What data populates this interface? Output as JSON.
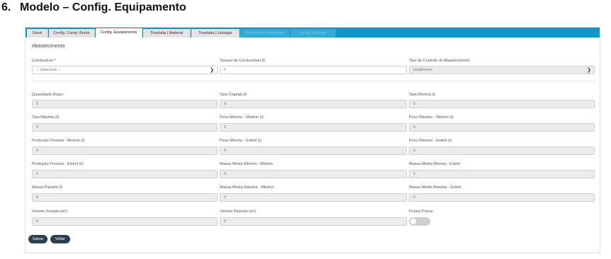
{
  "document": {
    "section_number": "6.",
    "section_title": "Modelo – Config. Equipamento"
  },
  "tabs": [
    {
      "label": "Geral",
      "state": "normal"
    },
    {
      "label": "Config. Comp. Bordo",
      "state": "normal"
    },
    {
      "label": "Config. Equipamento",
      "state": "active"
    },
    {
      "label": "Tonelada | Material",
      "state": "normal"
    },
    {
      "label": "Tonelada | Litologia",
      "state": "normal"
    },
    {
      "label": "Número de Passadas",
      "state": "disabled"
    },
    {
      "label": "Config. Explorer",
      "state": "disabled"
    }
  ],
  "abastecimento": {
    "title": "Abastecimento",
    "combustivel": {
      "label": "Combustível *",
      "value": "-- Selecione --"
    },
    "tanque": {
      "label": "Tanque de Combustível (l)",
      "value": "0"
    },
    "tipo_controle": {
      "label": "Tipo de Controle do Abastecimento",
      "value": "Hodômetro"
    }
  },
  "fields": {
    "quantidade_braco": {
      "label": "Quantidade Braço",
      "value": "0"
    },
    "tara_original": {
      "label": "Tara Original (t)",
      "value": "0"
    },
    "tara_minima": {
      "label": "Tara Mínima (t)",
      "value": "0"
    },
    "tara_maxima": {
      "label": "Tara Máxima (t)",
      "value": "0"
    },
    "peso_min_minerio": {
      "label": "Peso Mínimo - Minério (t)",
      "value": "0"
    },
    "peso_max_minerio": {
      "label": "Peso Máximo - Minério (t)",
      "value": "0"
    },
    "producao_prev_minerio": {
      "label": "Produção Prevista - Minério (t)",
      "value": "0"
    },
    "peso_min_esteril": {
      "label": "Peso Mínimo - Estéril (t)",
      "value": "0"
    },
    "peso_max_esteril": {
      "label": "Peso Máximo - Estéril (t)",
      "value": "0"
    },
    "producao_prev_esteril": {
      "label": "Produção Prevista - Estéril (t)",
      "value": "0"
    },
    "massa_media_min_minerio": {
      "label": "Massa Média Mínima - Minério",
      "value": "0"
    },
    "massa_media_min_esteril": {
      "label": "Massa Média Mínima - Estéril",
      "value": "0"
    },
    "massa_pazada": {
      "label": "Massa Pazada (t)",
      "value": "0"
    },
    "massa_media_max_minerio": {
      "label": "Massa Média Máxima - Minério",
      "value": "0"
    },
    "massa_media_max_esteril": {
      "label": "Massa Média Máxima - Estéril",
      "value": "0"
    },
    "volume_pazada": {
      "label": "Volume Pazada (m³)",
      "value": "0"
    },
    "volume_bascula": {
      "label": "Volume Báscula (m³)",
      "value": "0"
    },
    "possui_pneus": {
      "label": "Possui Pneus",
      "checked": false
    }
  },
  "buttons": {
    "save": "Salvar",
    "back": "Voltar"
  },
  "colors": {
    "tab_bar": "#1295c9",
    "button": "#2b3f50",
    "toggle_off": "#cfcfcf"
  }
}
